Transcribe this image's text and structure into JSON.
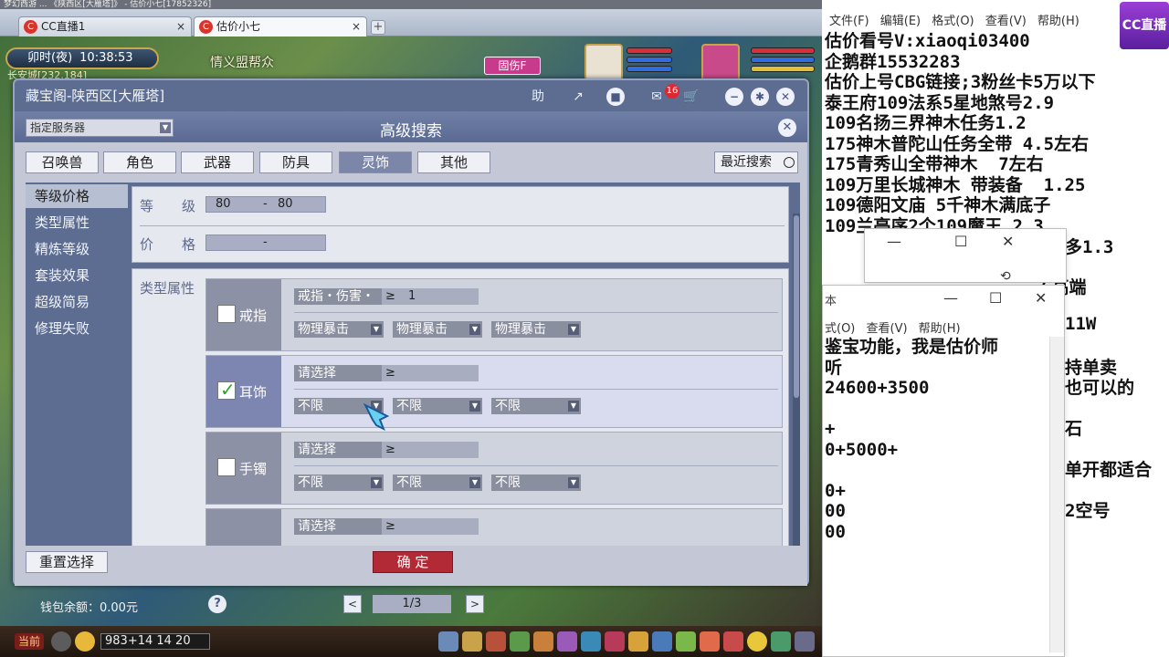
{
  "browser": {
    "title_strip": "梦幻西游 ... 《陕西区[大雁塔]》 - 估价小七[17852326]",
    "tabs": [
      {
        "label": "CC直播1",
        "close": "×"
      },
      {
        "label": "估价小七",
        "close": "×"
      }
    ],
    "add_tab": "+"
  },
  "hud": {
    "time_label": "卯时(夜)",
    "clock": "10:38:53",
    "location": "长安城[232,184]",
    "banner": "情义盟帮众",
    "status": "固伤F"
  },
  "shop": {
    "title": "藏宝阁-陕西区[大雁塔]",
    "help_btn": "助",
    "cart_badge": "16",
    "adv_title": "高级搜索",
    "server_select": "指定服务器",
    "categories": [
      "召唤兽",
      "角色",
      "武器",
      "防具",
      "灵饰",
      "其他"
    ],
    "active_category": "灵饰",
    "recent_search": "最近搜索",
    "side_menu": [
      "等级价格",
      "类型属性",
      "精炼等级",
      "套装效果",
      "超级简易",
      "修理失败"
    ],
    "level": {
      "label_a": "等",
      "label_b": "级",
      "min": "80",
      "sep": "-",
      "max": "80"
    },
    "price": {
      "label_a": "价",
      "label_b": "格",
      "sep": "-"
    },
    "type_label": "类型属性",
    "slots": [
      {
        "name": "戒指",
        "checked": false,
        "attr": "戒指・伤害・",
        "op": "≥",
        "value": "1",
        "opts": [
          "物理暴击",
          "物理暴击",
          "物理暴击"
        ]
      },
      {
        "name": "耳饰",
        "checked": true,
        "attr": "请选择",
        "op": "≥",
        "value": "",
        "opts": [
          "不限",
          "不限",
          "不限"
        ]
      },
      {
        "name": "手镯",
        "checked": false,
        "attr": "请选择",
        "op": "≥",
        "value": "",
        "opts": [
          "不限",
          "不限",
          "不限"
        ]
      },
      {
        "name": "",
        "checked": false,
        "attr": "请选择",
        "op": "≥",
        "value": "",
        "opts": []
      }
    ],
    "reset": "重置选择",
    "confirm": "确 定",
    "wallet": "钱包余额：0.00元",
    "help_q": "?",
    "prev": "<",
    "next": ">",
    "page": "1/3"
  },
  "bottom_bar": {
    "now": "当前",
    "coords": "983+14 14 20"
  },
  "notepad": {
    "menu": "文件(F) 编辑(E) 格式(O) 查看(V) 帮助(H)",
    "corner": "CC直播",
    "lines": "估价看号V:xiaoqi03400\n企鹅群15532283\n估价上号CBG链接;3粉丝卡5万以下\n泰王府109法系5星地煞号2.9\n109名扬三界神木任务1.2\n175神木普陀山任务全带 4.5左右\n175青秀山全带神木  7左右\n109万里长城神木 带装备  1.25\n109德阳文庙 5千神木满底子\n109兰亭序2个109魔王 2.3",
    "win2": {
      "min": "—",
      "max": "☐",
      "close": "✕"
    },
    "win3": {
      "title": "本",
      "min": "—",
      "max": "☐",
      "close": "✕",
      "menu": "式(O) 查看(V) 帮助(H)",
      "lines": "鉴宝功能，我是估价师\n听\n24600+3500\n\n+\n0+5000+\n\n0+\n00\n00"
    },
    "fragments": [
      "衣很多1.3",
      "右",
      "6高端",
      "11W",
      "持单卖",
      "也可以的",
      "石",
      "单开都适合",
      "2空号"
    ]
  }
}
